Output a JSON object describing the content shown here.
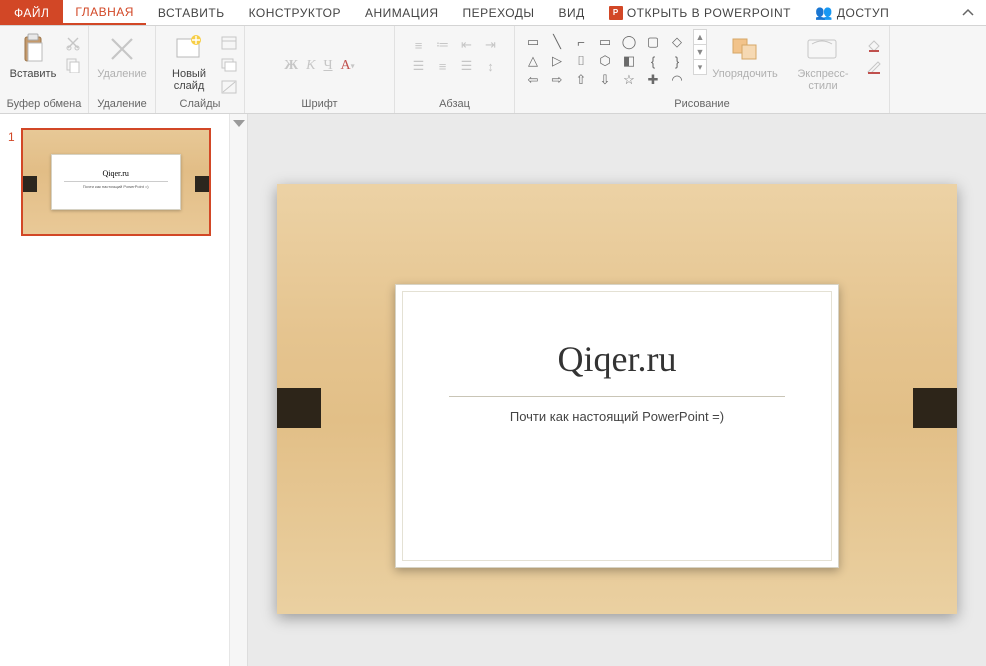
{
  "tabs": {
    "file": "ФАЙЛ",
    "home": "ГЛАВНАЯ",
    "insert": "ВСТАВИТЬ",
    "design": "КОНСТРУКТОР",
    "anim": "АНИМАЦИЯ",
    "trans": "ПЕРЕХОДЫ",
    "view": "ВИД",
    "open_pp": "ОТКРЫТЬ В POWERPOINT",
    "share": "ДОСТУП"
  },
  "ribbon": {
    "clipboard": {
      "paste": "Вставить",
      "label": "Буфер обмена"
    },
    "delete": {
      "btn": "Удаление",
      "label": "Удаление"
    },
    "slides": {
      "new": "Новый\nслайд",
      "label": "Слайды"
    },
    "font": {
      "label": "Шрифт"
    },
    "paragraph": {
      "label": "Абзац"
    },
    "drawing": {
      "arrange": "Упорядочить",
      "styles": "Экспресс-стили",
      "label": "Рисование"
    }
  },
  "thumbnail": {
    "number": "1"
  },
  "slide": {
    "title": "Qiqer.ru",
    "subtitle": "Почти как настоящий PowerPoint =)"
  }
}
